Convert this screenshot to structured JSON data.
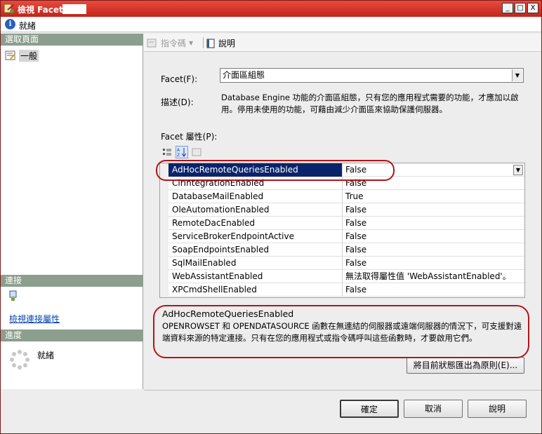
{
  "window": {
    "title": "檢視 Facet -",
    "controls": {
      "minimize": "_",
      "maximize": "□",
      "close": "X"
    }
  },
  "status": {
    "text": "就緒"
  },
  "left_pane": {
    "select_page_header": "選取頁面",
    "pages": [
      {
        "label": "一般",
        "icon": "properties-icon"
      }
    ],
    "connection_header": "連接",
    "connection_link": "檢視連接屬性",
    "progress_header": "進度",
    "progress_text": "就緒"
  },
  "toolbar": {
    "script_label": "指令碼",
    "help_label": "說明"
  },
  "facet": {
    "label": "Facet(F):",
    "value": "介面區組態",
    "description_label": "描述(D):",
    "description": "Database Engine 功能的介面區組態，只有您的應用程式需要的功能，才應加以啟用。停用未使用的功能，可藉由減少介面區來協助保護伺服器。"
  },
  "properties": {
    "label": "Facet 屬性(P):",
    "rows": [
      {
        "name": "AdHocRemoteQueriesEnabled",
        "value": "False"
      },
      {
        "name": "ClrIntegrationEnabled",
        "value": "False"
      },
      {
        "name": "DatabaseMailEnabled",
        "value": "True"
      },
      {
        "name": "OleAutomationEnabled",
        "value": "False"
      },
      {
        "name": "RemoteDacEnabled",
        "value": "False"
      },
      {
        "name": "ServiceBrokerEndpointActive",
        "value": "False"
      },
      {
        "name": "SoapEndpointsEnabled",
        "value": "False"
      },
      {
        "name": "SqlMailEnabled",
        "value": "False"
      },
      {
        "name": "WebAssistantEnabled",
        "value": "無法取得屬性值 'WebAssistantEnabled'。"
      },
      {
        "name": "XPCmdShellEnabled",
        "value": "False"
      }
    ]
  },
  "help": {
    "title": "AdHocRemoteQueriesEnabled",
    "text": "OPENROWSET 和 OPENDATASOURCE 函數在無連結的伺服器或遠端伺服器的情況下，可支援對遠端資料來源的特定連接。只有在您的應用程式或指令碼呼叫這些函數時，才要啟用它們。"
  },
  "buttons": {
    "export": "將目前狀態匯出為原則(E)...",
    "ok": "確定",
    "cancel": "取消",
    "help": "說明"
  },
  "colors": {
    "titlebar": "#d33427",
    "selection": "#0a246a",
    "highlight_ring": "#b2151a",
    "pane_header": "#8c9e8e"
  }
}
